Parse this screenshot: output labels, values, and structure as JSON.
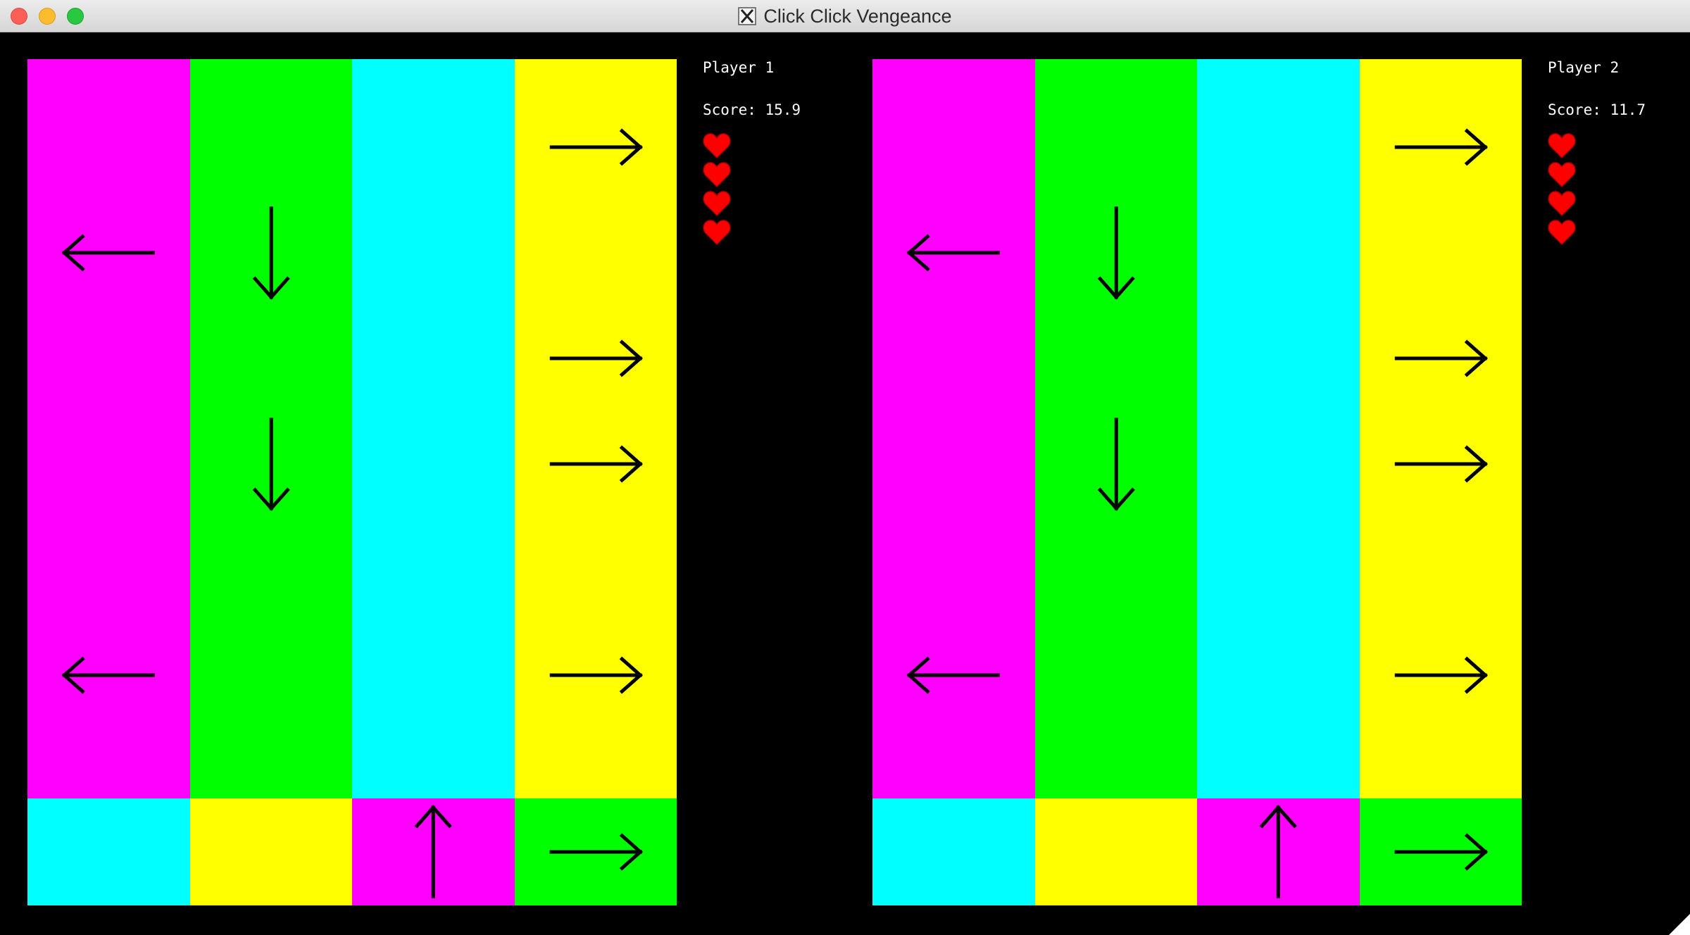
{
  "window": {
    "title": "Click Click Vengeance",
    "title_icon": "x11-icon"
  },
  "colors": {
    "magenta": "#ff00ff",
    "green": "#00ff00",
    "cyan": "#00ffff",
    "yellow": "#ffff00",
    "heart": "#ff0000",
    "background": "#000000"
  },
  "players": [
    {
      "name": "Player 1",
      "score_text": "Score: 15.9",
      "lives": 4,
      "lanes": [
        "magenta",
        "green",
        "cyan",
        "yellow"
      ],
      "targets": [
        {
          "color": "cyan",
          "arrow": null
        },
        {
          "color": "yellow",
          "arrow": null
        },
        {
          "color": "magenta",
          "arrow": "up"
        },
        {
          "color": "green",
          "arrow": "right"
        }
      ],
      "notes": [
        {
          "lane": 3,
          "row": 0,
          "arrow": "right"
        },
        {
          "lane": 0,
          "row": 1,
          "arrow": "left"
        },
        {
          "lane": 1,
          "row": 1,
          "arrow": "down"
        },
        {
          "lane": 3,
          "row": 2,
          "arrow": "right"
        },
        {
          "lane": 1,
          "row": 3,
          "arrow": "down"
        },
        {
          "lane": 3,
          "row": 3,
          "arrow": "right"
        },
        {
          "lane": 0,
          "row": 5,
          "arrow": "left"
        },
        {
          "lane": 3,
          "row": 5,
          "arrow": "right"
        }
      ]
    },
    {
      "name": "Player 2",
      "score_text": "Score: 11.7",
      "lives": 4,
      "lanes": [
        "magenta",
        "green",
        "cyan",
        "yellow"
      ],
      "targets": [
        {
          "color": "cyan",
          "arrow": null
        },
        {
          "color": "yellow",
          "arrow": null
        },
        {
          "color": "magenta",
          "arrow": "up"
        },
        {
          "color": "green",
          "arrow": "right"
        }
      ],
      "notes": [
        {
          "lane": 3,
          "row": 0,
          "arrow": "right"
        },
        {
          "lane": 0,
          "row": 1,
          "arrow": "left"
        },
        {
          "lane": 1,
          "row": 1,
          "arrow": "down"
        },
        {
          "lane": 3,
          "row": 2,
          "arrow": "right"
        },
        {
          "lane": 1,
          "row": 3,
          "arrow": "down"
        },
        {
          "lane": 3,
          "row": 3,
          "arrow": "right"
        },
        {
          "lane": 0,
          "row": 5,
          "arrow": "left"
        },
        {
          "lane": 3,
          "row": 5,
          "arrow": "right"
        }
      ]
    }
  ]
}
